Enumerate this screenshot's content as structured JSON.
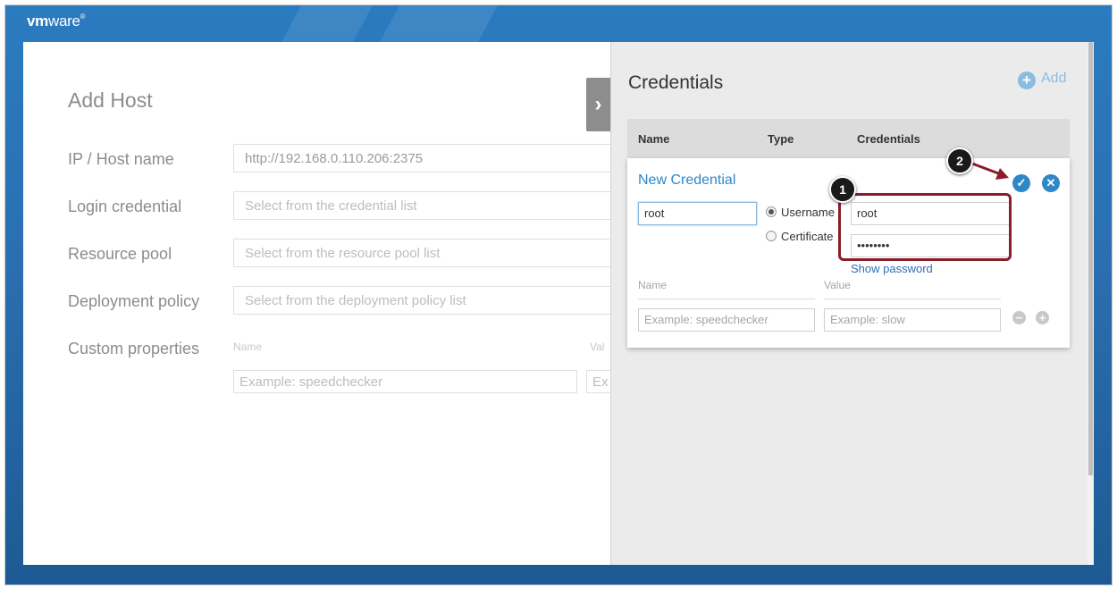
{
  "brand": {
    "logo_main": "vm",
    "logo_light": "ware",
    "logo_mark": "®"
  },
  "host_form": {
    "title": "Add Host",
    "fields": [
      {
        "label": "IP / Host name",
        "value": "http://192.168.0.110.206:2375",
        "placeholder": ""
      },
      {
        "label": "Login credential",
        "value": "",
        "placeholder": "Select from the credential list"
      },
      {
        "label": "Resource pool",
        "value": "",
        "placeholder": "Select from the resource pool list"
      },
      {
        "label": "Deployment policy",
        "value": "",
        "placeholder": "Select from the deployment policy list"
      }
    ],
    "custom_properties": {
      "label": "Custom properties",
      "name_header": "Name",
      "value_header": "Val",
      "name_placeholder": "Example: speedchecker",
      "value_placeholder": "Ex"
    },
    "collapse_icon": "chevron-right-icon"
  },
  "credentials_panel": {
    "title": "Credentials",
    "add_label": "Add",
    "add_icon": "plus-circle-icon",
    "columns": [
      "Name",
      "Type",
      "Credentials"
    ],
    "editor": {
      "title": "New Credential",
      "name_value": "root",
      "type_options": [
        {
          "label": "Username",
          "selected": true
        },
        {
          "label": "Certificate",
          "selected": false
        }
      ],
      "username_value": "root",
      "password_value": "••••••••",
      "show_password_label": "Show password",
      "properties": {
        "name_header": "Name",
        "value_header": "Value",
        "name_placeholder": "Example: speedchecker",
        "value_placeholder": "Example: slow"
      },
      "confirm_icon": "check-circle-icon",
      "cancel_icon": "close-circle-icon",
      "remove_row_icon": "minus-circle-icon",
      "add_row_icon": "plus-circle-icon"
    }
  },
  "annotations": {
    "step1": "1",
    "step2": "2"
  },
  "colors": {
    "accent": "#2f87c7",
    "header_gradient_top": "#2b7bc0",
    "highlight_border": "#8b1c2a"
  }
}
